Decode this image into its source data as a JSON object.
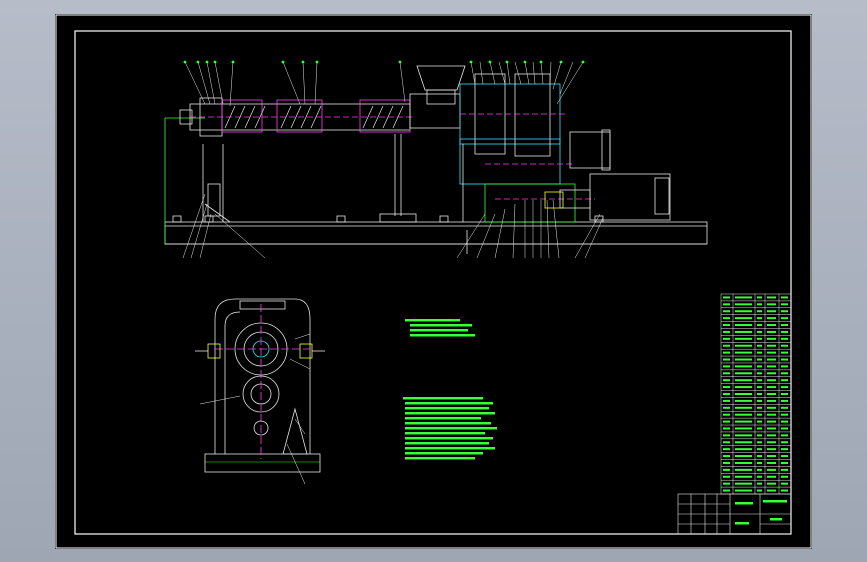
{
  "drawing": {
    "background": "#000000",
    "frame_color": "#ffffff",
    "line_main": "#e8e8e8",
    "line_green": "#39ff3a",
    "line_cyan": "#33e5ff",
    "line_magenta": "#ff3cf0",
    "line_yellow": "#ffff40",
    "text_color": "#39ff3a"
  },
  "parts_list": {
    "row_count": 29,
    "column_count": 5
  },
  "notes": {
    "block_one_lines": 4,
    "block_two_lines": 13
  },
  "title_block": {
    "cells": 6
  }
}
